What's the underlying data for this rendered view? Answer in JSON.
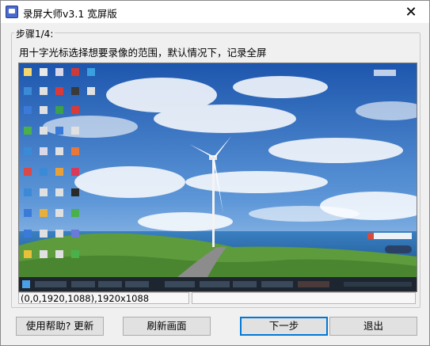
{
  "window": {
    "title": "录屏大师v3.1 宽屏版",
    "close_icon": "close-icon"
  },
  "group": {
    "label": "步骤1/4:",
    "instruction": "用十字光标选择想要录像的范围，默认情况下，记录全屏"
  },
  "preview": {
    "description_icon": "desktop-preview",
    "colors": {
      "sky_top": "#1f5fb8",
      "sky_bottom": "#9fc4ec",
      "sea": "#2a6fb0",
      "grass": "#5a9a3a",
      "taskbar": "#1c2530"
    }
  },
  "status": {
    "region": "(0,0,1920,1088),1920x1088",
    "extra": ""
  },
  "buttons": {
    "help": "使用帮助? 更新",
    "refresh": "刷新画面",
    "next": "下一步",
    "exit": "退出"
  }
}
